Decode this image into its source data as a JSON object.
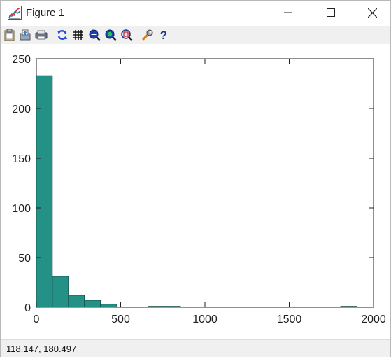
{
  "window": {
    "title": "Figure 1"
  },
  "toolbar": {
    "buttons": [
      "copy-icon",
      "export-icon",
      "print-icon",
      "refresh-icon",
      "grid-icon",
      "zoom-out-icon",
      "zoom-in-icon",
      "zoom-box-icon",
      "preferences-icon",
      "help-icon"
    ]
  },
  "status": {
    "coordinates": "118.147,  180.497"
  },
  "colors": {
    "bar_fill": "#239186",
    "bar_edge": "#1a4d46",
    "toolbar_bg": "#f0f0f0"
  },
  "chart_data": {
    "type": "bar",
    "subtype": "histogram",
    "title": "",
    "xlabel": "",
    "ylabel": "",
    "xlim": [
      0,
      2000
    ],
    "ylim": [
      0,
      250
    ],
    "xticks": [
      "0",
      "500",
      "1000",
      "1500",
      "2000"
    ],
    "yticks": [
      "0",
      "50",
      "100",
      "150",
      "200",
      "250"
    ],
    "bin_width": 95,
    "bin_starts": [
      0,
      95,
      190,
      285,
      380,
      475,
      570,
      665,
      760,
      855,
      950,
      1045,
      1140,
      1235,
      1330,
      1425,
      1520,
      1615,
      1710,
      1805
    ],
    "values": [
      233,
      31,
      12,
      7,
      3,
      0,
      0,
      1,
      1,
      0,
      0,
      0,
      0,
      0,
      0,
      0,
      0,
      0,
      0,
      1
    ],
    "grid": false
  }
}
